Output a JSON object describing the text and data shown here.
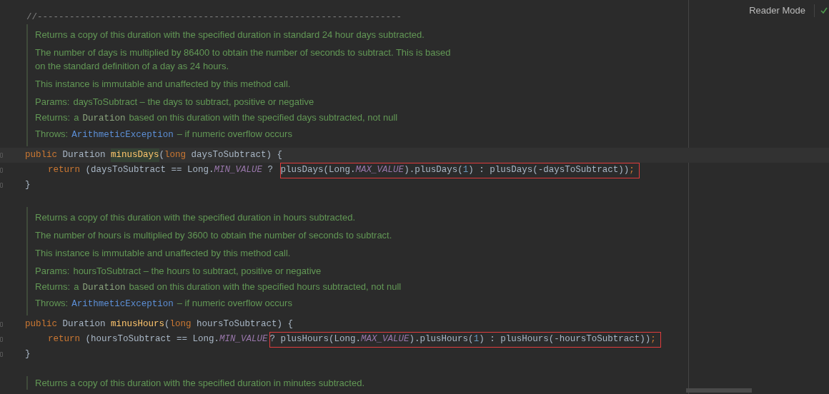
{
  "toolbar": {
    "reader_mode": "Reader Mode"
  },
  "separator_comment": "//--------------------------------------------------------------------",
  "methods": [
    {
      "doc": [
        {
          "kind": "text",
          "text": "Returns a copy of this duration with the specified duration in standard 24 hour days subtracted."
        },
        {
          "kind": "text",
          "text": "The number of days is multiplied by 86400 to obtain the number of seconds to subtract. This is based on the standard definition of a day as 24 hours."
        },
        {
          "kind": "text",
          "text": "This instance is immutable and unaffected by this method call."
        },
        {
          "kind": "tag",
          "label": "Params:",
          "parts": [
            {
              "kind": "text",
              "text": "daysToSubtract – the days to subtract, positive or negative"
            }
          ]
        },
        {
          "kind": "tag",
          "label": "Returns:",
          "parts": [
            {
              "kind": "text",
              "text": "a"
            },
            {
              "kind": "code",
              "text": "Duration"
            },
            {
              "kind": "text",
              "text": "based on this duration with the specified days subtracted, not null"
            }
          ]
        },
        {
          "kind": "tag",
          "label": "Throws:",
          "parts": [
            {
              "kind": "link",
              "text": "ArithmeticException"
            },
            {
              "kind": "text",
              "text": "– if numeric overflow occurs"
            }
          ]
        }
      ],
      "lines": [
        {
          "current": true,
          "indent": false,
          "tokens": [
            {
              "kind": "keyword",
              "text": "public "
            },
            {
              "kind": "plain",
              "text": "Duration "
            },
            {
              "kind": "method_marked",
              "text": "minusDays"
            },
            {
              "kind": "plain",
              "text": "("
            },
            {
              "kind": "keyword",
              "text": "long "
            },
            {
              "kind": "plain",
              "text": "daysToSubtract) {"
            }
          ]
        },
        {
          "current": false,
          "indent": true,
          "tokens": [
            {
              "kind": "keyword",
              "text": "return "
            },
            {
              "kind": "plain",
              "text": "(daysToSubtract == Long."
            },
            {
              "kind": "constant",
              "text": "MIN_VALUE"
            },
            {
              "kind": "plain",
              "text": " ? "
            }
          ],
          "boxed": [
            {
              "kind": "plain",
              "text": "plusDays(Long."
            },
            {
              "kind": "constant",
              "text": "MAX_VALUE"
            },
            {
              "kind": "plain",
              "text": ").plusDays("
            },
            {
              "kind": "number",
              "text": "1"
            },
            {
              "kind": "plain",
              "text": ") : plusDays(-daysToSubtract))"
            },
            {
              "kind": "keyword",
              "text": ";"
            }
          ]
        },
        {
          "current": false,
          "indent": false,
          "tokens": [
            {
              "kind": "plain",
              "text": "}"
            }
          ]
        }
      ]
    },
    {
      "doc": [
        {
          "kind": "text",
          "text": "Returns a copy of this duration with the specified duration in hours subtracted."
        },
        {
          "kind": "text",
          "text": "The number of hours is multiplied by 3600 to obtain the number of seconds to subtract."
        },
        {
          "kind": "text",
          "text": "This instance is immutable and unaffected by this method call."
        },
        {
          "kind": "tag",
          "label": "Params:",
          "parts": [
            {
              "kind": "text",
              "text": "hoursToSubtract – the hours to subtract, positive or negative"
            }
          ]
        },
        {
          "kind": "tag",
          "label": "Returns:",
          "parts": [
            {
              "kind": "text",
              "text": "a"
            },
            {
              "kind": "code",
              "text": "Duration"
            },
            {
              "kind": "text",
              "text": "based on this duration with the specified hours subtracted, not null"
            }
          ]
        },
        {
          "kind": "tag",
          "label": "Throws:",
          "parts": [
            {
              "kind": "link",
              "text": "ArithmeticException"
            },
            {
              "kind": "text",
              "text": "– if numeric overflow occurs"
            }
          ]
        }
      ],
      "lines": [
        {
          "current": false,
          "indent": false,
          "tokens": [
            {
              "kind": "keyword",
              "text": "public "
            },
            {
              "kind": "plain",
              "text": "Duration "
            },
            {
              "kind": "method",
              "text": "minusHours"
            },
            {
              "kind": "plain",
              "text": "("
            },
            {
              "kind": "keyword",
              "text": "long "
            },
            {
              "kind": "plain",
              "text": "hoursToSubtract) {"
            }
          ]
        },
        {
          "current": false,
          "indent": true,
          "tokens": [
            {
              "kind": "keyword",
              "text": "return "
            },
            {
              "kind": "plain",
              "text": "(hoursToSubtract == Long."
            },
            {
              "kind": "constant",
              "text": "MIN_VALUE"
            }
          ],
          "boxed": [
            {
              "kind": "plain",
              "text": "? plusHours(Long."
            },
            {
              "kind": "constant",
              "text": "MAX_VALUE"
            },
            {
              "kind": "plain",
              "text": ").plusHours("
            },
            {
              "kind": "number",
              "text": "1"
            },
            {
              "kind": "plain",
              "text": ") : plusHours(-hoursToSubtract))"
            },
            {
              "kind": "keyword",
              "text": ";"
            }
          ]
        },
        {
          "current": false,
          "indent": false,
          "tokens": [
            {
              "kind": "plain",
              "text": "}"
            }
          ]
        }
      ]
    }
  ],
  "trailing_doc": "Returns a copy of this duration with the specified duration in minutes subtracted."
}
